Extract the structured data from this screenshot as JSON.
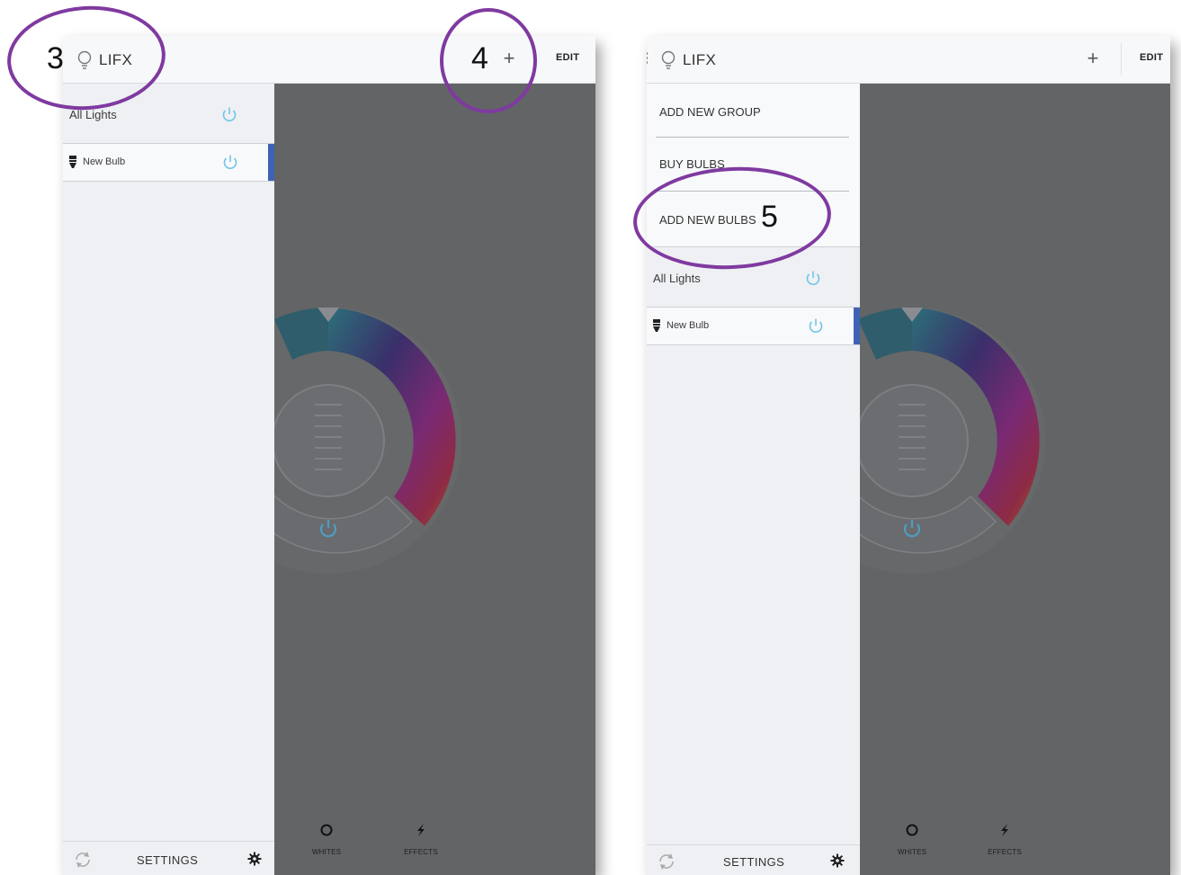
{
  "screen_left": {
    "app_title": "LIFX",
    "add_label": "+",
    "edit_label": "EDIT",
    "lights": [
      {
        "label": "All Lights"
      },
      {
        "label": "New Bulb"
      }
    ],
    "footer": {
      "settings_label": "SETTINGS"
    },
    "tools": {
      "whites": "WHITES",
      "effects": "EFFECTS"
    }
  },
  "screen_right": {
    "app_title": "LIFX",
    "add_label": "+",
    "edit_label": "EDIT",
    "add_menu": [
      {
        "label": "ADD NEW GROUP"
      },
      {
        "label": "BUY BULBS"
      },
      {
        "label": "ADD NEW BULBS"
      }
    ],
    "lights": [
      {
        "label": "All Lights"
      },
      {
        "label": "New Bulb"
      }
    ],
    "footer": {
      "settings_label": "SETTINGS"
    },
    "tools": {
      "whites": "WHITES",
      "effects": "EFFECTS"
    }
  },
  "annotations": [
    {
      "number": "3"
    },
    {
      "number": "4"
    },
    {
      "number": "5"
    }
  ],
  "colors": {
    "annotation_ring": "#7f3aa0",
    "selection_bar": "#3e63b4",
    "power_icon": "#6ec6e6",
    "backdrop": "#636466"
  }
}
